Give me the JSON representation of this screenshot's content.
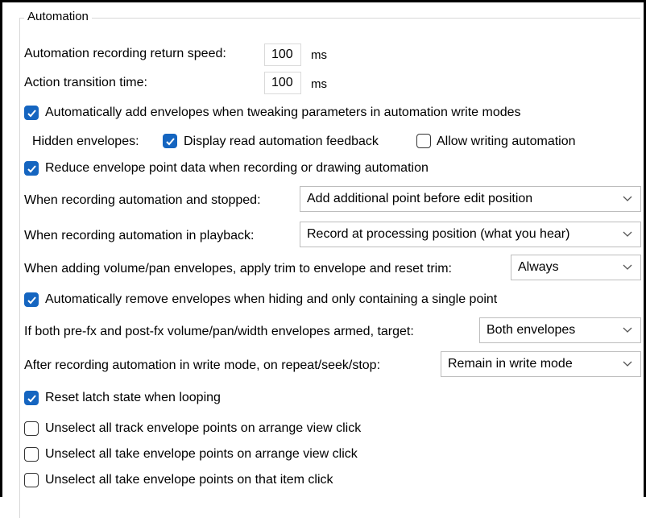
{
  "group": {
    "title": "Automation"
  },
  "recording_return_speed": {
    "label": "Automation recording return speed:",
    "value": "100",
    "unit": "ms"
  },
  "action_transition": {
    "label": "Action transition time:",
    "value": "100",
    "unit": "ms"
  },
  "checkboxes": {
    "auto_add": {
      "label": "Automatically add envelopes when tweaking parameters in automation write modes",
      "checked": true
    },
    "display_read": {
      "label": "Display read automation feedback",
      "checked": true
    },
    "allow_writing": {
      "label": "Allow writing automation",
      "checked": false
    },
    "reduce_point_data": {
      "label": "Reduce envelope point data when recording or drawing automation",
      "checked": true
    },
    "auto_remove": {
      "label": "Automatically remove envelopes when hiding and only containing a single point",
      "checked": true
    },
    "reset_latch": {
      "label": "Reset latch state when looping",
      "checked": true
    },
    "unselect_track": {
      "label": "Unselect all track envelope points on arrange view click",
      "checked": false
    },
    "unselect_take": {
      "label": "Unselect all take envelope points on arrange view click",
      "checked": false
    },
    "unselect_item": {
      "label": "Unselect all take envelope points on that item click",
      "checked": false
    }
  },
  "hidden_envelopes": {
    "label": "Hidden envelopes:"
  },
  "dropdowns": {
    "stopped": {
      "label": "When recording automation and stopped:",
      "value": "Add additional point before edit position"
    },
    "playback": {
      "label": "When recording automation in playback:",
      "value": "Record at processing position (what you hear)"
    },
    "trim": {
      "label": "When adding volume/pan envelopes, apply trim to envelope and reset trim:",
      "value": "Always"
    },
    "target": {
      "label": "If both pre-fx and post-fx volume/pan/width envelopes armed, target:",
      "value": "Both envelopes"
    },
    "after_write": {
      "label": "After recording automation in write mode, on repeat/seek/stop:",
      "value": "Remain in write mode"
    }
  },
  "colors": {
    "accent": "#1565c0",
    "border": "#bdbdbd"
  },
  "icons": {
    "check": "checkmark-icon",
    "dropdown": "chevron-down-icon"
  }
}
